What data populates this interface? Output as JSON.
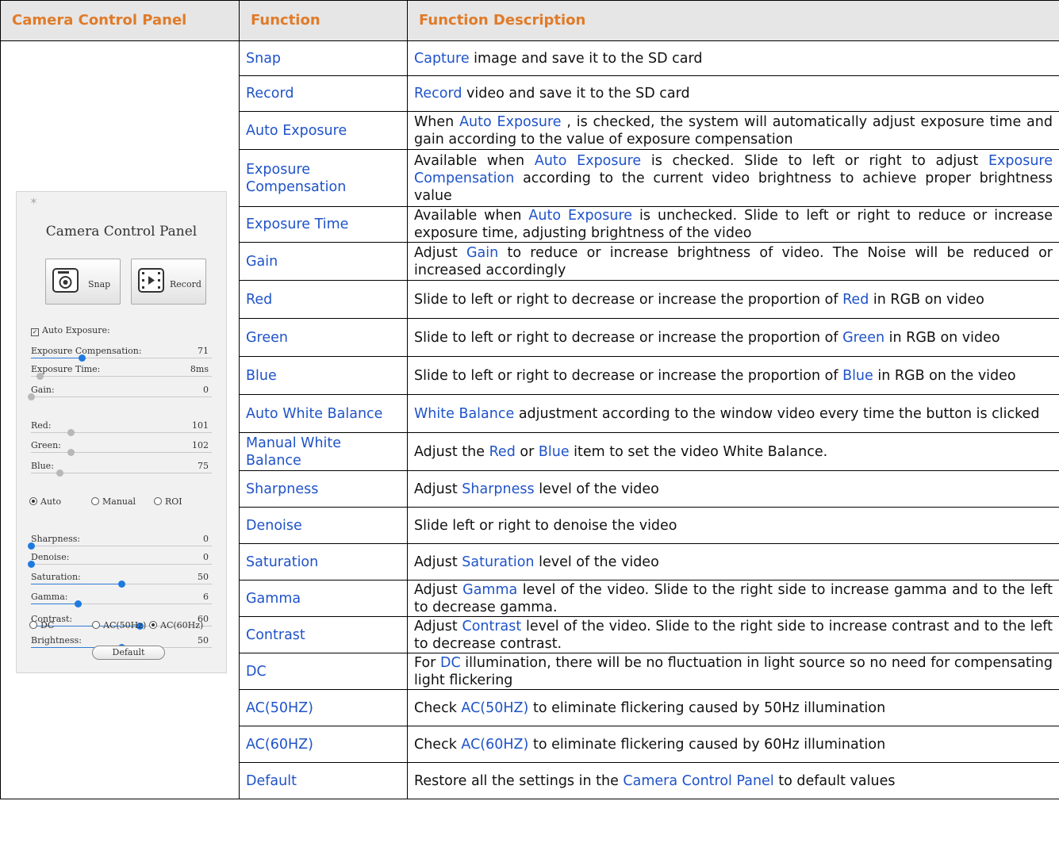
{
  "headers": [
    "Camera Control Panel",
    "Function",
    "Function Description"
  ],
  "rows": [
    {
      "fn": "Snap",
      "desc": [
        [
          "kw",
          "Capture"
        ],
        [
          "",
          "image and save it to the SD card"
        ]
      ]
    },
    {
      "fn": "Record",
      "desc": [
        [
          "kw",
          "Record"
        ],
        [
          "",
          "video and save it to the SD card"
        ]
      ]
    },
    {
      "fn": "Auto Exposure",
      "desc": [
        [
          "",
          "When "
        ],
        [
          "kw",
          "Auto Exposure"
        ],
        [
          "",
          ", is checked, the system will automatically adjust exposure time and gain according to the value of exposure compensation"
        ]
      ]
    },
    {
      "fn": "Exposure Compensation",
      "desc": [
        [
          "",
          "Available when "
        ],
        [
          "kw",
          "Auto Exposure"
        ],
        [
          "",
          "is checked. Slide to left or right to adjust "
        ],
        [
          "kw",
          "Exposure Compensation"
        ],
        [
          "",
          "according to the current video brightness to achieve proper brightness value"
        ]
      ]
    },
    {
      "fn": "Exposure Time",
      "desc": [
        [
          "",
          "Available when "
        ],
        [
          "kw",
          "Auto Exposure"
        ],
        [
          "",
          "is unchecked. Slide to left or right to reduce or increase exposure time, adjusting brightness of the video"
        ]
      ]
    },
    {
      "fn": "Gain",
      "desc": [
        [
          "",
          "Adjust "
        ],
        [
          "kw",
          "Gain"
        ],
        [
          "",
          "to reduce or increase brightness of video. The Noise will be reduced or increased accordingly"
        ]
      ]
    },
    {
      "fn": "Red",
      "desc": [
        [
          "",
          "Slide to left or right to decrease or increase the proportion of "
        ],
        [
          "kw",
          "Red"
        ],
        [
          "",
          "in RGB on video"
        ]
      ]
    },
    {
      "fn": "Green",
      "desc": [
        [
          "",
          "Slide to left or right to decrease or increase the proportion of "
        ],
        [
          "kw",
          "Green"
        ],
        [
          "",
          "in RGB on video"
        ]
      ]
    },
    {
      "fn": "Blue",
      "desc": [
        [
          "",
          "Slide to left or right to decrease or increase the proportion of "
        ],
        [
          "kw",
          "Blue"
        ],
        [
          "",
          "in RGB on the video"
        ]
      ]
    },
    {
      "fn": "Auto White Balance",
      "desc": [
        [
          "kw",
          "White Balance"
        ],
        [
          "",
          "adjustment according to the window video every time the button is clicked"
        ]
      ]
    },
    {
      "fn": "Manual White Balance",
      "desc": [
        [
          "",
          "Adjust the "
        ],
        [
          "kw",
          "Red"
        ],
        [
          "",
          "or "
        ],
        [
          "kw",
          "Blue"
        ],
        [
          "",
          "item to set the video White Balance."
        ]
      ]
    },
    {
      "fn": "Sharpness",
      "desc": [
        [
          "",
          "Adjust "
        ],
        [
          "kw",
          "Sharpness"
        ],
        [
          "",
          "level of the video"
        ]
      ]
    },
    {
      "fn": "Denoise",
      "desc": [
        [
          "",
          "Slide left or right to denoise the video"
        ]
      ]
    },
    {
      "fn": "Saturation",
      "desc": [
        [
          "",
          "Adjust "
        ],
        [
          "kw",
          "Saturation"
        ],
        [
          "",
          "level of the video"
        ]
      ]
    },
    {
      "fn": "Gamma",
      "desc": [
        [
          "",
          "Adjust "
        ],
        [
          "kw",
          "Gamma"
        ],
        [
          "",
          "level of the video. Slide to the right side to increase gamma and to the left to decrease gamma."
        ]
      ]
    },
    {
      "fn": "Contrast",
      "desc": [
        [
          "",
          "Adjust "
        ],
        [
          "kw",
          "Contrast"
        ],
        [
          "",
          "level of the video. Slide to the right side to increase contrast and to the left to decrease contrast."
        ]
      ]
    },
    {
      "fn": "DC",
      "desc": [
        [
          "",
          "For "
        ],
        [
          "kw",
          "DC"
        ],
        [
          "",
          "illumination, there will be no fluctuation in light source so no need for compensating light flickering"
        ]
      ]
    },
    {
      "fn": "AC(50HZ)",
      "desc": [
        [
          "",
          "Check "
        ],
        [
          "kw",
          "AC(50HZ)"
        ],
        [
          "",
          "to eliminate flickering caused by 50Hz illumination"
        ]
      ]
    },
    {
      "fn": "AC(60HZ)",
      "desc": [
        [
          "",
          "Check "
        ],
        [
          "kw",
          "AC(60HZ)"
        ],
        [
          "",
          "to eliminate flickering caused by 60Hz illumination"
        ]
      ]
    },
    {
      "fn": "Default",
      "desc": [
        [
          "",
          "Restore all the settings in the "
        ],
        [
          "kw",
          "Camera Control Panel"
        ],
        [
          "",
          "to default values"
        ]
      ]
    }
  ],
  "panel": {
    "title": "Camera Control Panel",
    "snap_label": "Snap",
    "record_label": "Record",
    "auto_exposure_label": "Auto Exposure:",
    "auto_exposure_checked": true,
    "sliders": [
      {
        "label": "Exposure Compensation:",
        "value": "71",
        "level": 0.28,
        "style": "blue"
      },
      {
        "label": "Exposure Time:",
        "value": "8ms",
        "level": 0.05,
        "style": "grey"
      },
      {
        "label": "Gain:",
        "value": "0",
        "level": 0.0,
        "style": "grey"
      },
      {
        "label": "Red:",
        "value": "101",
        "level": 0.22,
        "style": "grey"
      },
      {
        "label": "Green:",
        "value": "102",
        "level": 0.22,
        "style": "grey"
      },
      {
        "label": "Blue:",
        "value": "75",
        "level": 0.16,
        "style": "grey"
      },
      {
        "label": "Sharpness:",
        "value": "0",
        "level": 0.0,
        "style": "blue"
      },
      {
        "label": "Denoise:",
        "value": "0",
        "level": 0.0,
        "style": "blue"
      },
      {
        "label": "Saturation:",
        "value": "50",
        "level": 0.5,
        "style": "blue"
      },
      {
        "label": "Gamma:",
        "value": "6",
        "level": 0.26,
        "style": "blue"
      },
      {
        "label": "Contrast:",
        "value": "60",
        "level": 0.6,
        "style": "blue"
      },
      {
        "label": "Brightness:",
        "value": "50",
        "level": 0.5,
        "style": "blue"
      }
    ],
    "wb_modes": [
      {
        "label": "Auto",
        "selected": true
      },
      {
        "label": "Manual",
        "selected": false
      },
      {
        "label": "ROI",
        "selected": false
      }
    ],
    "power_modes": [
      {
        "label": "DC",
        "selected": false
      },
      {
        "label": "AC(50Hz)",
        "selected": false
      },
      {
        "label": "AC(60Hz)",
        "selected": true
      }
    ],
    "default_label": "Default"
  }
}
